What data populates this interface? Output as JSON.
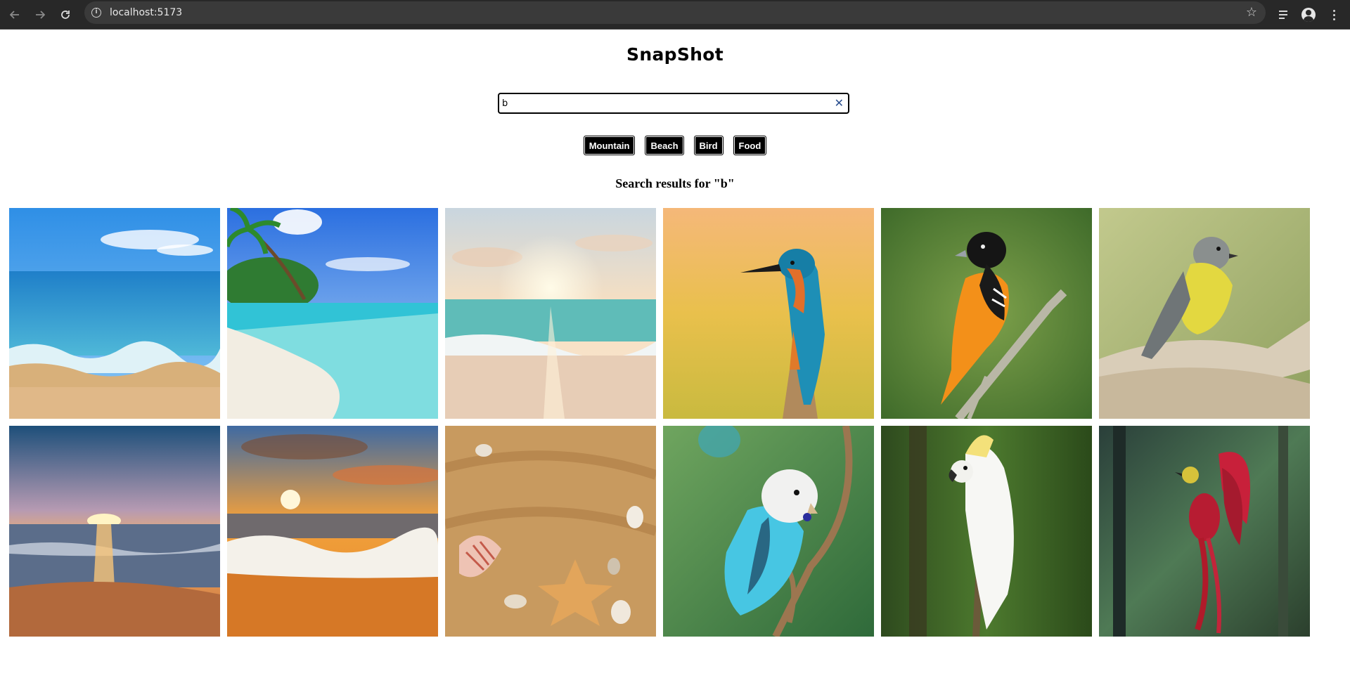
{
  "browser": {
    "url": "localhost:5173",
    "icons": [
      "back-icon",
      "forward-icon",
      "reload-icon",
      "site-info-icon",
      "bookmark-star-icon",
      "media-controls-icon",
      "profile-icon",
      "menu-icon"
    ]
  },
  "app": {
    "title": "SnapShot",
    "search": {
      "value": "b",
      "placeholder": "",
      "clear_glyph": "✕"
    },
    "filters": [
      {
        "label": "Mountain"
      },
      {
        "label": "Beach"
      },
      {
        "label": "Bird"
      },
      {
        "label": "Food"
      }
    ],
    "results_heading": "Search results for \"b\""
  },
  "gallery": [
    {
      "subject": "beach",
      "scene": "ocean waves on sandy beach under blue sky"
    },
    {
      "subject": "beach",
      "scene": "tropical white sand beach with palm tree"
    },
    {
      "subject": "beach",
      "scene": "sunrise over calm shoreline"
    },
    {
      "subject": "bird",
      "scene": "kingfisher perched on stump"
    },
    {
      "subject": "bird",
      "scene": "orange oriole on branch"
    },
    {
      "subject": "bird",
      "scene": "grey and yellow robin on branch"
    },
    {
      "subject": "beach",
      "scene": "sunset over ocean"
    },
    {
      "subject": "beach",
      "scene": "orange sunset with foamy waves"
    },
    {
      "subject": "beach",
      "scene": "seashells and starfish in sand"
    },
    {
      "subject": "bird",
      "scene": "blue budgerigar on branch"
    },
    {
      "subject": "bird",
      "scene": "white cockatoo on branch"
    },
    {
      "subject": "bird",
      "scene": "red bird of paradise in forest"
    }
  ]
}
